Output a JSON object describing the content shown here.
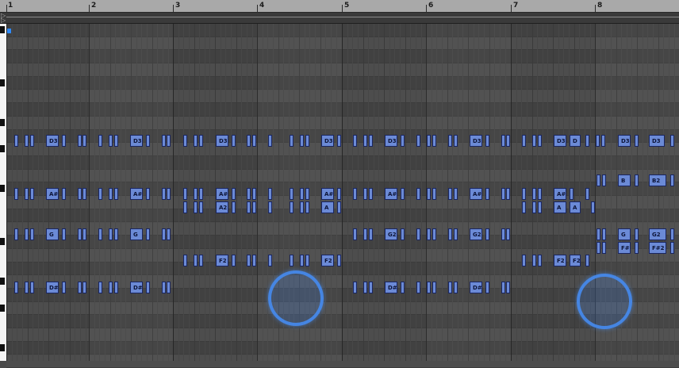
{
  "ruler": {
    "bars": [
      "1",
      "2",
      "3",
      "4",
      "5",
      "6",
      "7",
      "8"
    ]
  },
  "loop": {
    "icon_top": "loop-start-arrow-icon",
    "icon_bottom": "loop-end-arrow-icon"
  },
  "colors": {
    "note_fill": "#6b8ad6",
    "note_border": "#1a2660",
    "touch_indicator": "#468cf0",
    "playhead": "#2e8bff"
  },
  "notes": [
    {
      "label": "D3"
    },
    {
      "label": "D3"
    },
    {
      "label": "D3"
    },
    {
      "label": "D3"
    },
    {
      "label": "D3"
    },
    {
      "label": "D3"
    },
    {
      "label": "D3"
    },
    {
      "label": "D"
    },
    {
      "label": "D3"
    },
    {
      "label": "D3"
    },
    {
      "label": "B"
    },
    {
      "label": "B2"
    },
    {
      "label": "A#"
    },
    {
      "label": "A#"
    },
    {
      "label": "A#"
    },
    {
      "label": "A#"
    },
    {
      "label": "A#"
    },
    {
      "label": "A#"
    },
    {
      "label": "A#"
    },
    {
      "label": "A2"
    },
    {
      "label": "A"
    },
    {
      "label": "A"
    },
    {
      "label": "A"
    },
    {
      "label": "G"
    },
    {
      "label": "G"
    },
    {
      "label": "G2"
    },
    {
      "label": "G2"
    },
    {
      "label": "G"
    },
    {
      "label": "G2"
    },
    {
      "label": "F#"
    },
    {
      "label": "F#2"
    },
    {
      "label": "F2"
    },
    {
      "label": "F2"
    },
    {
      "label": "F2"
    },
    {
      "label": "F2"
    },
    {
      "label": "D#"
    },
    {
      "label": "D#"
    },
    {
      "label": "D#"
    },
    {
      "label": "D#"
    }
  ]
}
